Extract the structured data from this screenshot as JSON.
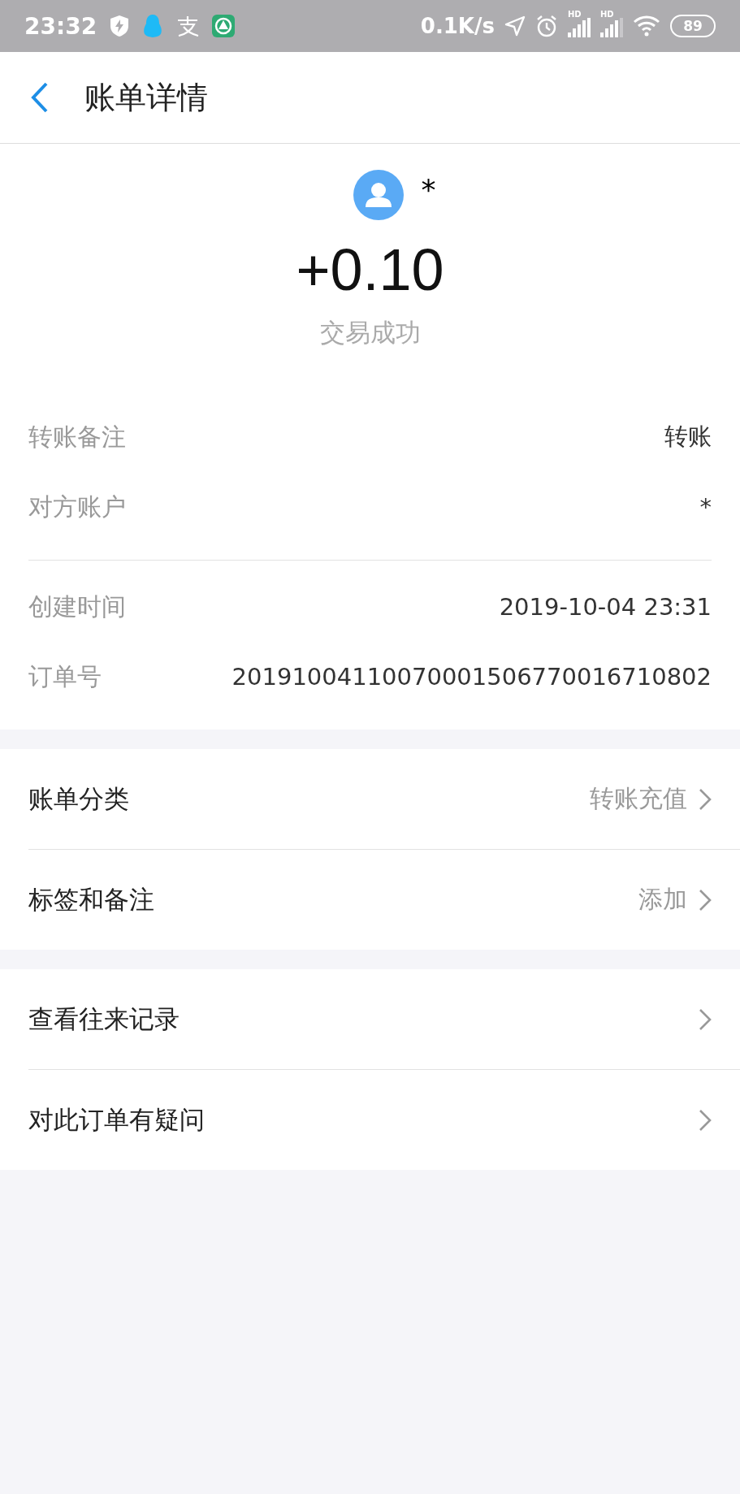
{
  "status_bar": {
    "time": "23:32",
    "speed": "0.1K/s",
    "signal_labels": [
      "HD",
      "HD"
    ],
    "battery": "89"
  },
  "header": {
    "title": "账单详情"
  },
  "summary": {
    "payee": "*",
    "amount": "+0.10",
    "status": "交易成功"
  },
  "details": [
    [
      {
        "label": "转账备注",
        "value": "转账"
      },
      {
        "label": "对方账户",
        "value": "*"
      }
    ],
    [
      {
        "label": "创建时间",
        "value": "2019-10-04 23:31"
      },
      {
        "label": "订单号",
        "value": "20191004110070001506770016710802"
      }
    ]
  ],
  "menu_groups": [
    [
      {
        "label": "账单分类",
        "value": "转账充值"
      },
      {
        "label": "标签和备注",
        "value": "添加"
      }
    ],
    [
      {
        "label": "查看往来记录"
      },
      {
        "label": "对此订单有疑问"
      }
    ]
  ]
}
